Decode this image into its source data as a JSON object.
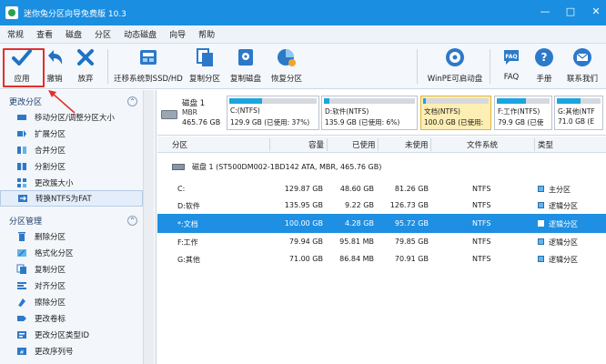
{
  "window": {
    "title": "迷你兔分区向导免费版 10.3",
    "buttons": {
      "minimize": "—",
      "maximize": "□",
      "close": "✕"
    }
  },
  "menu": [
    "常规",
    "查看",
    "磁盘",
    "分区",
    "动态磁盘",
    "向导",
    "帮助"
  ],
  "toolbar": {
    "apply": "应用",
    "undo": "撤销",
    "discard": "放弃",
    "migrate": "迁移系统到SSD/HD",
    "copy_partition": "复制分区",
    "copy_disk": "复制磁盘",
    "restore_partition": "恢复分区",
    "winpe": "WinPE可启动盘",
    "faq": "FAQ",
    "manual": "手册",
    "contact": "联系我们"
  },
  "sidebar": {
    "section1": {
      "title": "更改分区",
      "items": [
        {
          "label": "移动分区/调整分区大小",
          "icon": "move-resize-icon"
        },
        {
          "label": "扩展分区",
          "icon": "extend-icon"
        },
        {
          "label": "合并分区",
          "icon": "merge-icon"
        },
        {
          "label": "分割分区",
          "icon": "split-icon"
        },
        {
          "label": "更改簇大小",
          "icon": "cluster-icon"
        },
        {
          "label": "转换NTFS为FAT",
          "icon": "convert-icon",
          "selected": true
        }
      ]
    },
    "section2": {
      "title": "分区管理",
      "items": [
        {
          "label": "删除分区",
          "icon": "delete-icon"
        },
        {
          "label": "格式化分区",
          "icon": "format-icon"
        },
        {
          "label": "复制分区",
          "icon": "copy-icon"
        },
        {
          "label": "对齐分区",
          "icon": "align-icon"
        },
        {
          "label": "擦除分区",
          "icon": "wipe-icon"
        },
        {
          "label": "更改卷标",
          "icon": "label-icon"
        },
        {
          "label": "更改分区类型ID",
          "icon": "type-id-icon"
        },
        {
          "label": "更改序列号",
          "icon": "serial-icon"
        }
      ]
    }
  },
  "diskmap": {
    "disk": {
      "name": "磁盘 1",
      "type": "MBR",
      "size": "465.76 GB"
    },
    "partitions": [
      {
        "name": "C:(NTFS)",
        "info": "129.9 GB (已使用: 37%)",
        "used": 0.37
      },
      {
        "name": "D:软件(NTFS)",
        "info": "135.9 GB (已使用: 6%)",
        "used": 0.06
      },
      {
        "name": "文档(NTFS)",
        "info": "100.0 GB (已使用:",
        "used": 0.04,
        "selected": true
      },
      {
        "name": "F:工作(NTFS)",
        "info": "79.9 GB (已使",
        "used": 0.55
      },
      {
        "name": "G:其他(NTF",
        "info": "71.0 GB (E",
        "used": 0.55
      }
    ]
  },
  "table": {
    "headers": [
      "分区",
      "容量",
      "已使用",
      "未使用",
      "文件系统",
      "类型"
    ],
    "disk_row": "磁盘 1 (ST500DM002-1BD142 ATA, MBR, 465.76 GB)",
    "rows": [
      {
        "partition": "C:",
        "capacity": "129.87 GB",
        "used": "48.60 GB",
        "unused": "81.26 GB",
        "fs": "NTFS",
        "type": "主分区"
      },
      {
        "partition": "D:软件",
        "capacity": "135.95 GB",
        "used": "9.22 GB",
        "unused": "126.73 GB",
        "fs": "NTFS",
        "type": "逻辑分区"
      },
      {
        "partition": "*:文档",
        "capacity": "100.00 GB",
        "used": "4.28 GB",
        "unused": "95.72 GB",
        "fs": "NTFS",
        "type": "逻辑分区",
        "selected": true
      },
      {
        "partition": "F:工作",
        "capacity": "79.94 GB",
        "used": "95.81 MB",
        "unused": "79.85 GB",
        "fs": "NTFS",
        "type": "逻辑分区"
      },
      {
        "partition": "G:其他",
        "capacity": "71.00 GB",
        "used": "86.84 MB",
        "unused": "70.91 GB",
        "fs": "NTFS",
        "type": "逻辑分区"
      }
    ]
  },
  "colors": {
    "titlebar": "#1a8ee0",
    "selection": "#1e8fe2",
    "highlight_box": "#e0302b",
    "usage_bar": "#1aa5df"
  }
}
